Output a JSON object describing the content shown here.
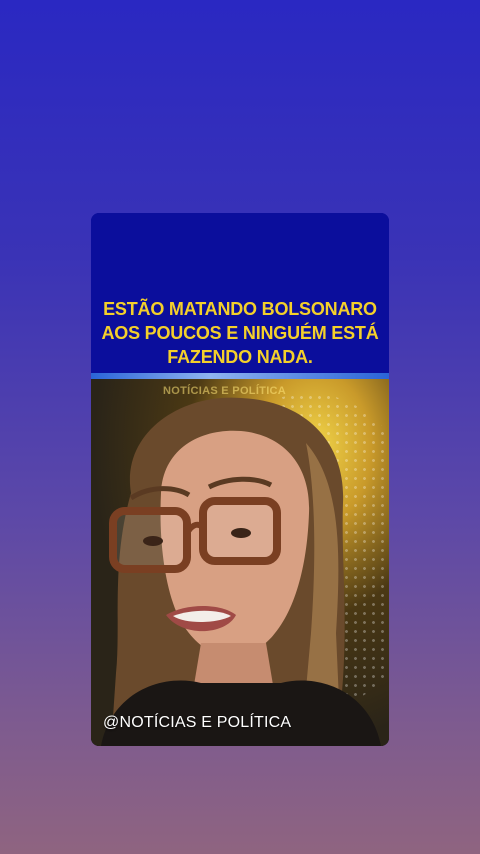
{
  "story": {
    "headline_lines": [
      "ESTÃO MATANDO BOLSONARO",
      "AOS POUCOS E NINGUÉM ESTÁ",
      "FAZENDO NADA."
    ],
    "video_watermark": "NOTÍCIAS E POLÍTICA",
    "handle": "@NOTÍCIAS E POLÍTICA"
  },
  "colors": {
    "headline_text": "#f4d02a",
    "headline_band": "#0b0e9c",
    "background_top": "#2a28c2",
    "background_bottom": "#8f6480"
  }
}
